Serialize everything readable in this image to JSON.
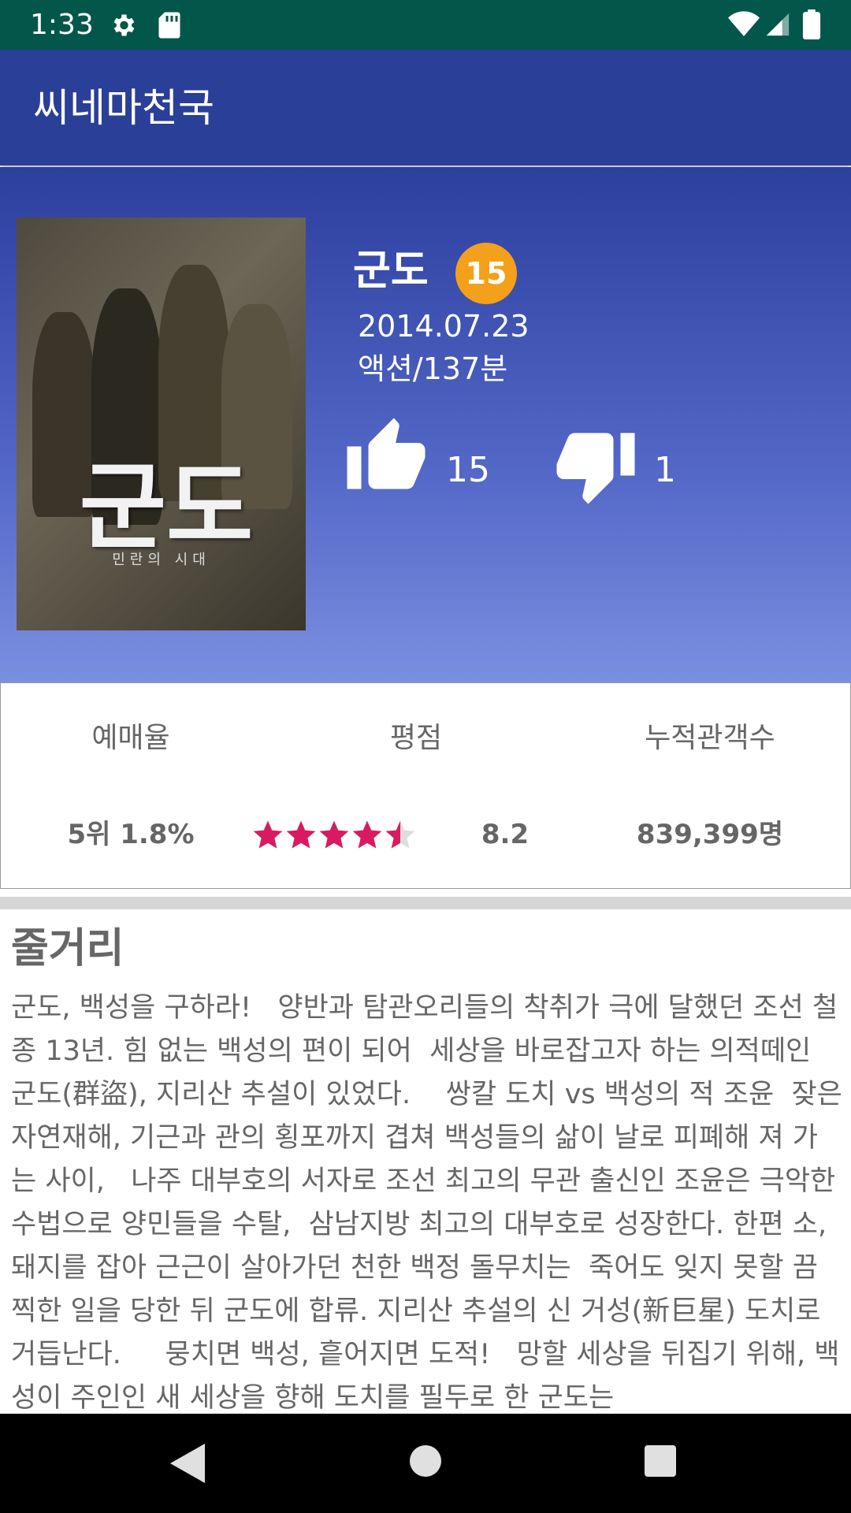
{
  "status_bar": {
    "time": "1:33"
  },
  "app_bar": {
    "title": "씨네마천국"
  },
  "movie": {
    "title": "군도",
    "age_rating": "15",
    "release_date": "2014.07.23",
    "genre_duration": "액션/137분",
    "likes": "15",
    "dislikes": "1",
    "poster": {
      "title_text": "군도",
      "subtitle_text": "민란의 시대"
    }
  },
  "stats": {
    "reservation_label": "예매율",
    "reservation_value": "5위 1.8%",
    "rating_label": "평점",
    "rating_value": "8.2",
    "star_rating": 4.5,
    "audience_label": "누적관객수",
    "audience_value": "839,399명"
  },
  "synopsis": {
    "heading": "줄거리",
    "text": "군도, 백성을 구하라!   양반과 탐관오리들의 착취가 극에 달했던 조선 철종 13년. 힘 없는 백성의 편이 되어  세상을 바로잡고자 하는 의적떼인 군도(群盜), 지리산 추설이 있었다.    쌍칼 도치 vs 백성의 적 조윤  잦은 자연재해, 기근과 관의 횡포까지 겹쳐 백성들의 삶이 날로 피폐해 져 가는 사이,   나주 대부호의 서자로 조선 최고의 무관 출신인 조윤은 극악한 수법으로 양민들을 수탈,  삼남지방 최고의 대부호로 성장한다. 한편 소, 돼지를 잡아 근근이 살아가던 천한 백정 돌무치는  죽어도 잊지 못할 끔찍한 일을 당한 뒤 군도에 합류. 지리산 추설의 신 거성(新巨星) 도치로 거듭난다.     뭉치면 백성, 흩어지면 도적!   망할 세상을 뒤집기 위해, 백성이 주인인 새 세상을 향해 도치를 필두로 한 군도는"
  },
  "colors": {
    "status_bar": "#03574a",
    "app_bar": "#2a3f98",
    "badge": "#f5a01a",
    "star": "#d81b60"
  }
}
